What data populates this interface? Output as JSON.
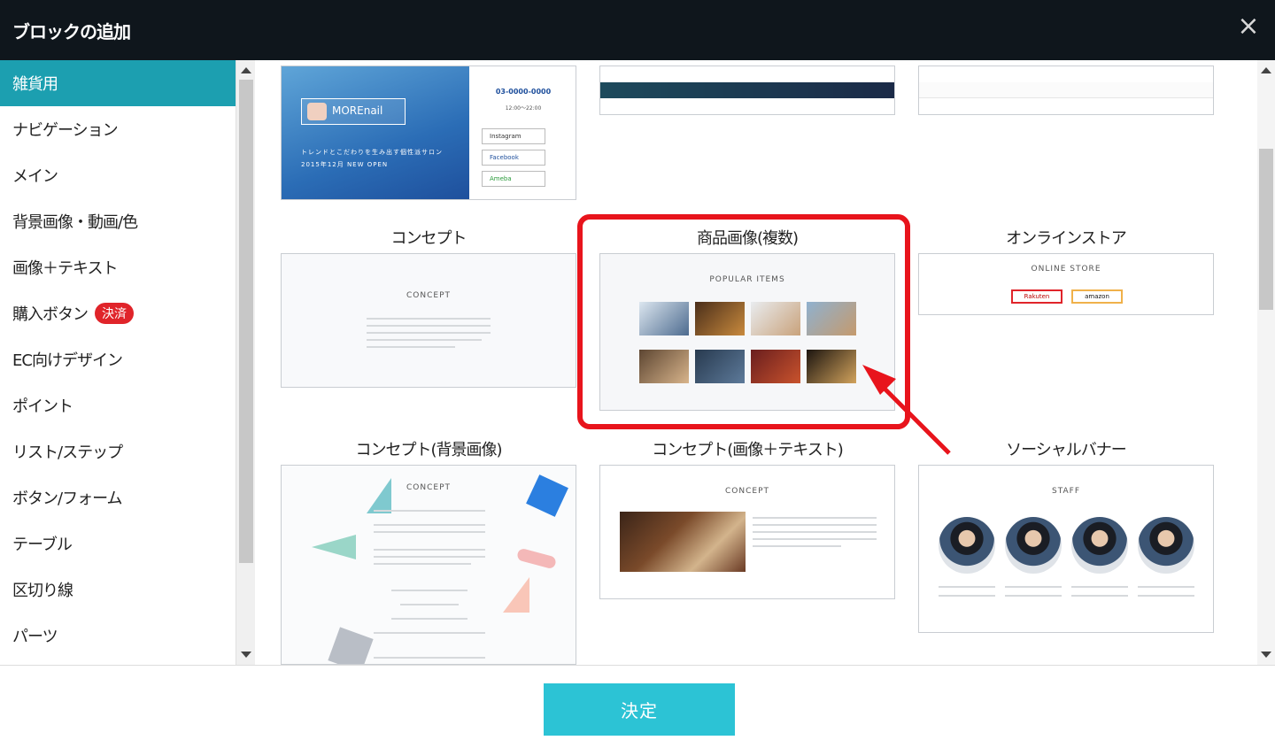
{
  "dialog": {
    "title": "ブロックの追加",
    "close_glyph": "×"
  },
  "sidebar": {
    "items": [
      {
        "label": "雑貨用",
        "active": true
      },
      {
        "label": "ナビゲーション"
      },
      {
        "label": "メイン"
      },
      {
        "label": "背景画像・動画/色"
      },
      {
        "label": "画像＋テキスト"
      },
      {
        "label": "購入ボタン",
        "badge": "決済"
      },
      {
        "label": "EC向けデザイン"
      },
      {
        "label": "ポイント"
      },
      {
        "label": "リスト/ステップ"
      },
      {
        "label": "ボタン/フォーム"
      },
      {
        "label": "テーブル"
      },
      {
        "label": "区切り線"
      },
      {
        "label": "パーツ"
      }
    ]
  },
  "blocks": {
    "main_hero": {
      "brand": "MOREnail",
      "tagline": "トレンドとこだわりを生み出す個性派サロン",
      "opening": "2015年12月 NEW OPEN",
      "tel": "03-0000-0000",
      "hours": "12:00〜22:00",
      "instagram": "Instagram",
      "facebook": "Facebook",
      "ameba": "Ameba"
    },
    "concept": {
      "label": "コンセプト",
      "heading": "CONCEPT"
    },
    "product_images": {
      "label": "商品画像(複数)",
      "heading": "POPULAR ITEMS"
    },
    "online_store": {
      "label": "オンラインストア",
      "heading": "ONLINE STORE",
      "rakuten": "Rakuten",
      "amazon": "amazon"
    },
    "concept_bg": {
      "label": "コンセプト(背景画像)",
      "heading": "CONCEPT"
    },
    "concept_img_text": {
      "label": "コンセプト(画像＋テキスト)",
      "heading": "CONCEPT"
    },
    "social_banner": {
      "label": "ソーシャルバナー",
      "heading": "STAFF"
    }
  },
  "footer": {
    "confirm_label": "決定"
  },
  "colors": {
    "header_bg": "#0f161c",
    "active_item": "#1c9fb0",
    "badge": "#e0242a",
    "confirm_button": "#2cc3d5",
    "highlight": "#e8141c"
  }
}
